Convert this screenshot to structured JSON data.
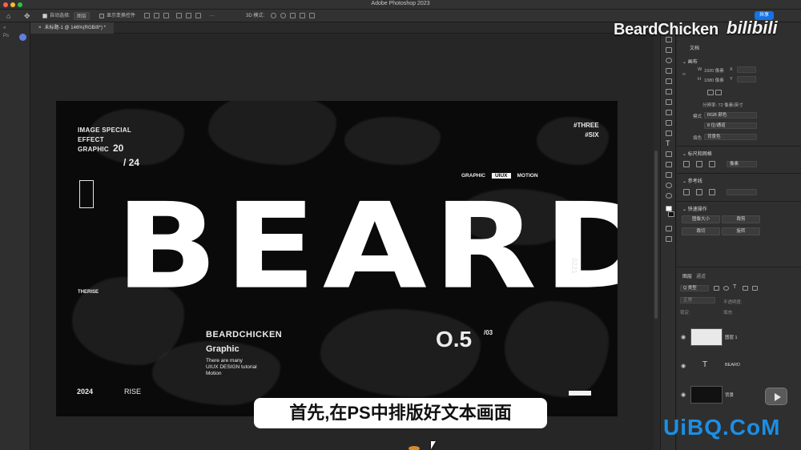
{
  "window": {
    "app_title": "Adobe Photoshop 2023"
  },
  "options_bar": {
    "auto_select_label": "自动选择:",
    "auto_select_value": "图层",
    "show_transform_label": "显示变换控件",
    "mode_3d_label": "3D 模式:",
    "share_label": "共享"
  },
  "document": {
    "tab_label": "未标题-1 @ 146%(RGB/8*) *"
  },
  "canvas": {
    "image_special": [
      "IMAGE SPECIAL",
      "EFFECT",
      "GRAPHIC"
    ],
    "num_20": "20",
    "num_24": "/ 24",
    "three_six": [
      "#THREE",
      "#SIX"
    ],
    "graphic_row": [
      "GRAPHIC",
      "UIUX",
      "MOTION"
    ],
    "headline": "BEARD",
    "vertical_num": "0221",
    "therise": "THERISE",
    "beardchicken": "BEARDCHICKEN",
    "graphic": "Graphic",
    "many_lines": [
      "There are many",
      "UIUX DESIGN tutorial",
      "Motion"
    ],
    "big_num": "O.5",
    "small_num": "/03",
    "year": "2024",
    "rise": "RISE"
  },
  "panels": {
    "doc_label": "文档",
    "canvas_section": "画布",
    "width_label": "W",
    "width_value": "1920 像素",
    "height_label": "H",
    "height_value": "1080 像素",
    "x_label": "X",
    "y_label": "Y",
    "resolution": "分辨率: 72 像素/英寸",
    "mode_label": "模式",
    "mode_value": "RGB 颜色",
    "bit_value": "8 位/通道",
    "fill_label": "填色",
    "fill_value": "背景色",
    "rulers_section": "标尺和网格",
    "unit_value": "像素",
    "guides_section": "参考线",
    "quick_actions": "快速操作",
    "btn_image_size": "图像大小",
    "btn_crop": "裁剪",
    "btn_cut": "裁切",
    "btn_rotate": "旋转",
    "layers_tab": "图层",
    "channels_tab": "通道",
    "kind_label": "Q 类型",
    "blend_mode": "正常",
    "opacity_label": "不透明度:",
    "lock_label": "锁定:",
    "fill2_label": "填充:",
    "layers": [
      {
        "name": "图层 1"
      },
      {
        "name": "BEARD"
      },
      {
        "name": "背景"
      }
    ]
  },
  "watermarks": {
    "author": "BeardChicken",
    "site": "bilibili",
    "uibq": "UiBQ.CoM"
  },
  "subtitle": "首先,在PS中排版好文本画面",
  "colors": {
    "accent": "#1473e6",
    "uibq": "#1b8fe6",
    "canvas_bg": "#0a0a0a",
    "app_bg": "#2a2a2a"
  }
}
